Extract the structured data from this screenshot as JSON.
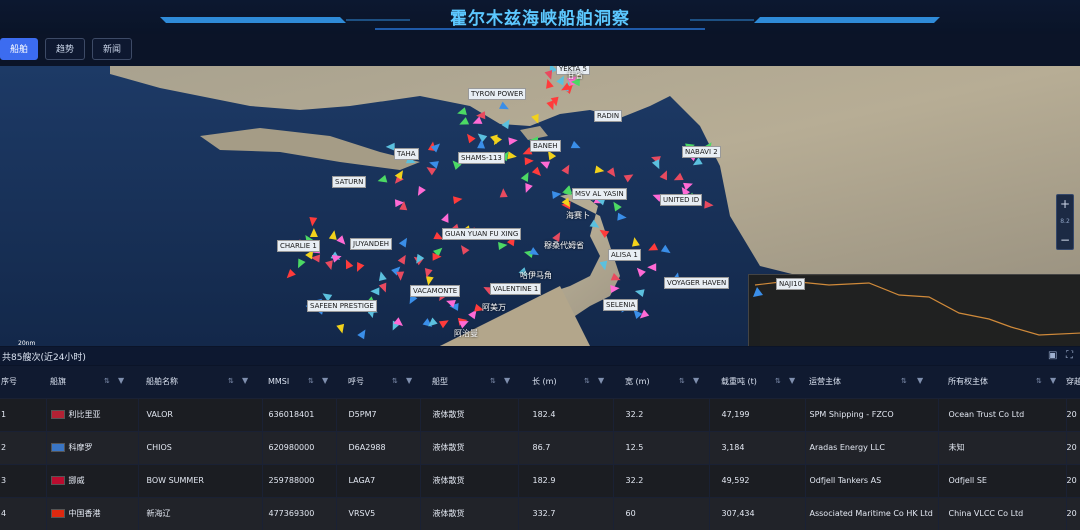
{
  "header": {
    "title": "霍尔木兹海峡船舶洞察"
  },
  "tabs": [
    {
      "label": "船舶",
      "active": true
    },
    {
      "label": "趋势",
      "active": false
    },
    {
      "label": "新闻",
      "active": false
    }
  ],
  "map": {
    "zoom_level": "8.2",
    "zoom_in": "+",
    "zoom_out": "−",
    "scale_label": "20nm",
    "vessel_labels": [
      "YEKTA 5",
      "TYRON POWER",
      "RADIN",
      "TAHA",
      "SHAMS-113",
      "BANEH",
      "NABAVI 2",
      "SATURN",
      "MSV AL YASIN",
      "UNITED ID",
      "GUAN YUAN FU XING",
      "CHARLIE 1",
      "JUYANDEH",
      "ALISA 1",
      "VOYAGER HAVEN",
      "VALENTINE 1",
      "VACAMONTE",
      "SAFEEN PRESTIGE",
      "SELENIA",
      "NAJI10"
    ],
    "place_labels": [
      "甘省",
      "海赛卜",
      "穆桑代姆省",
      "哈伊马角",
      "阿治曼",
      "阿美万"
    ]
  },
  "summary": {
    "text": "共85艘次(近24小时)"
  },
  "table": {
    "columns": [
      "序号",
      "船旗",
      "船舶名称",
      "MMSI",
      "呼号",
      "船型",
      "长 (m)",
      "宽 (m)",
      "载重吨 (t)",
      "运营主体",
      "所有权主体",
      "穿越"
    ],
    "rows": [
      {
        "index": "1",
        "flag": "利比里亚",
        "flag_color": "#b22234",
        "name": "VALOR",
        "mmsi": "636018401",
        "callsign": "D5PM7",
        "type": "液体散货",
        "length": "182.4",
        "width": "32.2",
        "dwt": "47,199",
        "operator": "SPM Shipping - FZCO",
        "owner": "Ocean Trust Co Ltd",
        "cross": "20"
      },
      {
        "index": "2",
        "flag": "科摩罗",
        "flag_color": "#3a75c4",
        "name": "CHIOS",
        "mmsi": "620980000",
        "callsign": "D6A2988",
        "type": "液体散货",
        "length": "86.7",
        "width": "12.5",
        "dwt": "3,184",
        "operator": "Aradas Energy LLC",
        "owner": "未知",
        "cross": "20"
      },
      {
        "index": "3",
        "flag": "挪威",
        "flag_color": "#ba0c2f",
        "name": "BOW SUMMER",
        "mmsi": "259788000",
        "callsign": "LAGA7",
        "type": "液体散货",
        "length": "182.9",
        "width": "32.2",
        "dwt": "49,592",
        "operator": "Odfjell Tankers AS",
        "owner": "Odfjell SE",
        "cross": "20"
      },
      {
        "index": "4",
        "flag": "中国香港",
        "flag_color": "#de2910",
        "name": "新海辽",
        "mmsi": "477369300",
        "callsign": "VRSV5",
        "type": "液体散货",
        "length": "332.7",
        "width": "60",
        "dwt": "307,434",
        "operator": "Associated Maritime Co HK Ltd",
        "owner": "China VLCC Co Ltd",
        "cross": "20"
      }
    ]
  },
  "colors": {
    "accent": "#3c6cf0",
    "title": "#5cc8ff"
  }
}
